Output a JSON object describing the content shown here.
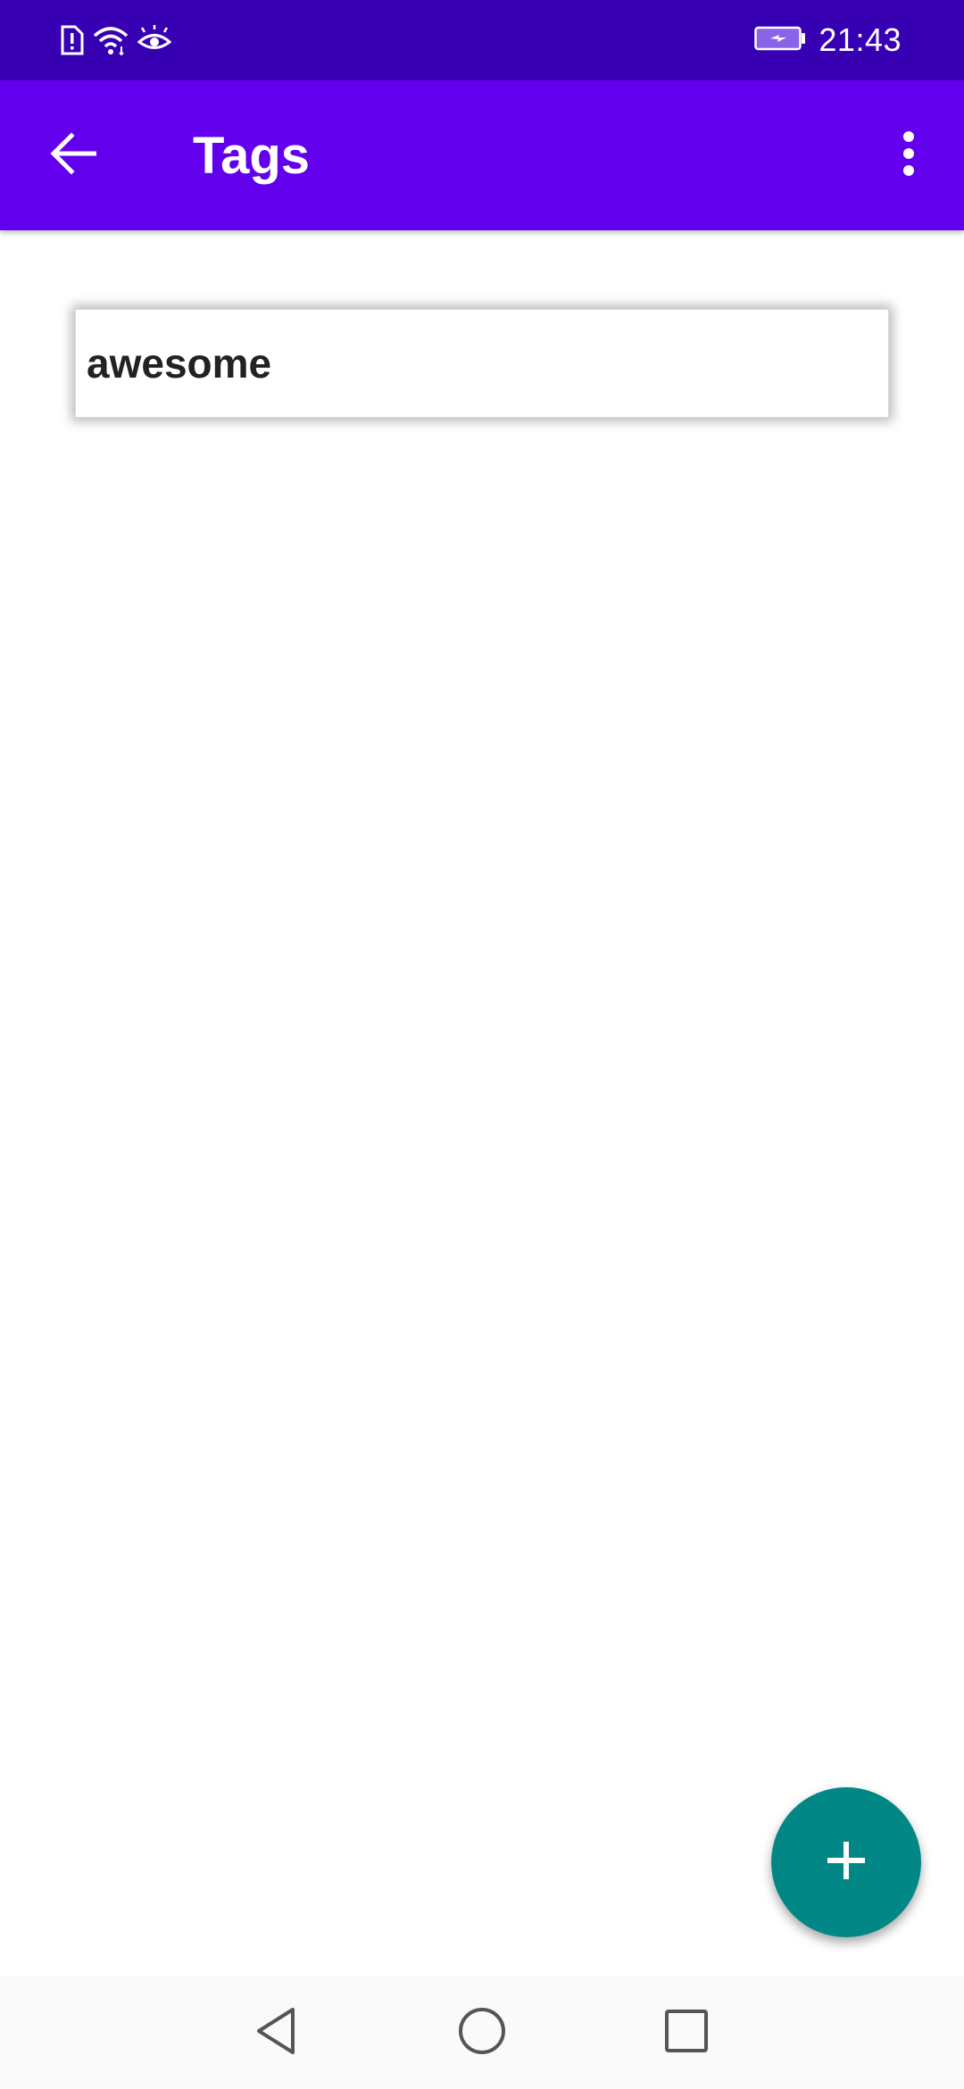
{
  "status_bar": {
    "time": "21:43",
    "icons": [
      "sim-alert-icon",
      "wifi-icon",
      "eye-comfort-icon",
      "battery-charging-icon"
    ]
  },
  "app_bar": {
    "title": "Tags",
    "back_icon": "arrow-back-icon",
    "menu_icon": "more-vert-icon"
  },
  "tags": [
    {
      "label": "awesome"
    }
  ],
  "fab": {
    "icon": "plus-icon"
  },
  "nav_bar": {
    "icons": [
      "nav-back-icon",
      "nav-home-icon",
      "nav-recents-icon"
    ]
  },
  "colors": {
    "status_bar": "#3700b3",
    "app_bar": "#6200ee",
    "fab": "#018786"
  }
}
